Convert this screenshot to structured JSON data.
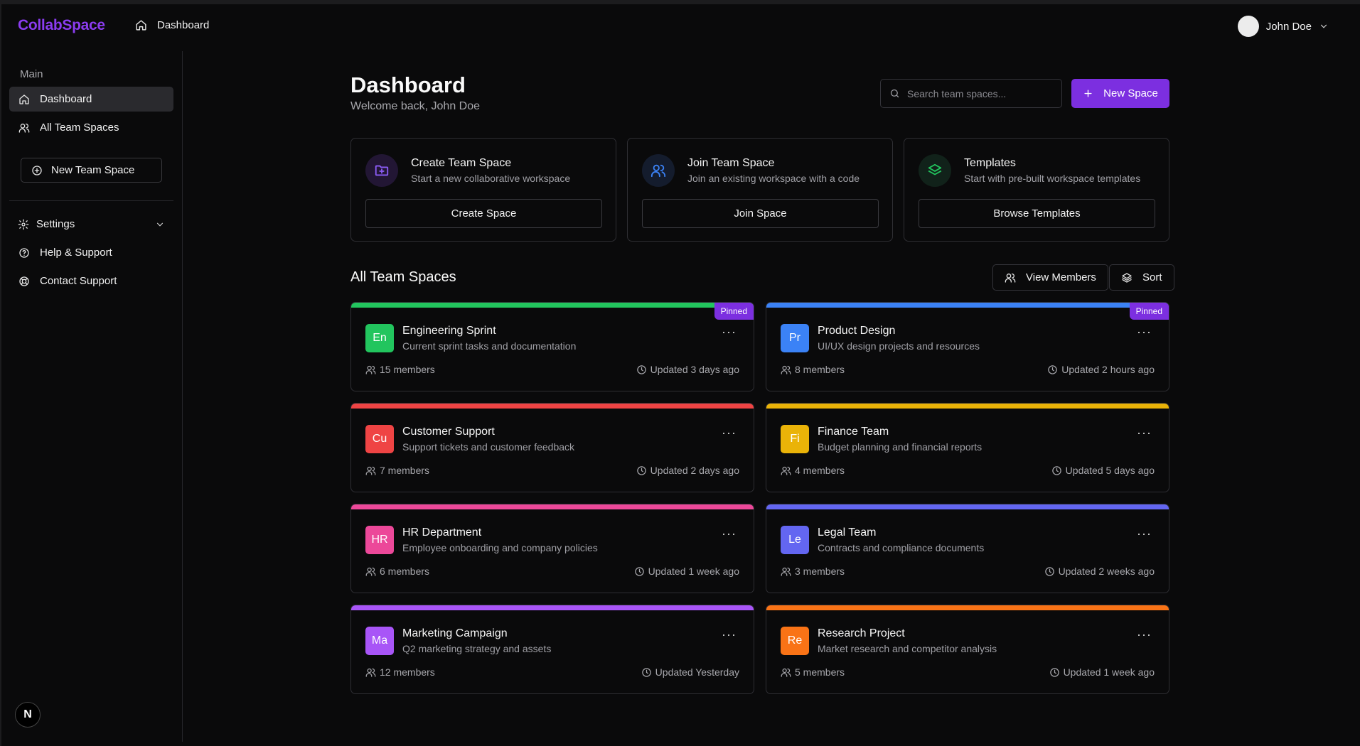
{
  "app": {
    "brand": "CollabSpace"
  },
  "header": {
    "breadcrumb": "Dashboard",
    "user_name": "John Doe"
  },
  "sidebar": {
    "section_heading": "Main",
    "items": [
      {
        "label": "Dashboard",
        "icon": "home-icon",
        "active": true
      },
      {
        "label": "All Team Spaces",
        "icon": "users-icon",
        "active": false
      }
    ],
    "new_team_space": "New Team Space",
    "settings": "Settings",
    "help": "Help & Support",
    "contact": "Contact Support",
    "footer_badge": "N"
  },
  "page": {
    "title": "Dashboard",
    "subtitle": "Welcome back, John Doe",
    "search_placeholder": "Search team spaces...",
    "new_space_button": "New Space"
  },
  "actions": [
    {
      "title": "Create Team Space",
      "desc": "Start a new collaborative workspace",
      "button": "Create Space",
      "icon": "folder-plus-icon",
      "color": "#8b5cf6"
    },
    {
      "title": "Join Team Space",
      "desc": "Join an existing workspace with a code",
      "button": "Join Space",
      "icon": "users-icon",
      "color": "#3b82f6"
    },
    {
      "title": "Templates",
      "desc": "Start with pre-built workspace templates",
      "button": "Browse Templates",
      "icon": "layers-icon",
      "color": "#22c55e"
    }
  ],
  "spaces_section": {
    "title": "All Team Spaces",
    "view_members": "View Members",
    "sort": "Sort"
  },
  "spaces": [
    {
      "initials": "En",
      "name": "Engineering Sprint",
      "desc": "Current sprint tasks and documentation",
      "members": "15 members",
      "updated": "Updated 3 days ago",
      "color": "#22c55e",
      "pinned": "Pinned"
    },
    {
      "initials": "Pr",
      "name": "Product Design",
      "desc": "UI/UX design projects and resources",
      "members": "8 members",
      "updated": "Updated 2 hours ago",
      "color": "#3b82f6",
      "pinned": "Pinned"
    },
    {
      "initials": "Cu",
      "name": "Customer Support",
      "desc": "Support tickets and customer feedback",
      "members": "7 members",
      "updated": "Updated 2 days ago",
      "color": "#ef4444",
      "pinned": ""
    },
    {
      "initials": "Fi",
      "name": "Finance Team",
      "desc": "Budget planning and financial reports",
      "members": "4 members",
      "updated": "Updated 5 days ago",
      "color": "#eab308",
      "pinned": ""
    },
    {
      "initials": "HR",
      "name": "HR Department",
      "desc": "Employee onboarding and company policies",
      "members": "6 members",
      "updated": "Updated 1 week ago",
      "color": "#ec4899",
      "pinned": ""
    },
    {
      "initials": "Le",
      "name": "Legal Team",
      "desc": "Contracts and compliance documents",
      "members": "3 members",
      "updated": "Updated 2 weeks ago",
      "color": "#6366f1",
      "pinned": ""
    },
    {
      "initials": "Ma",
      "name": "Marketing Campaign",
      "desc": "Q2 marketing strategy and assets",
      "members": "12 members",
      "updated": "Updated Yesterday",
      "color": "#a855f7",
      "pinned": ""
    },
    {
      "initials": "Re",
      "name": "Research Project",
      "desc": "Market research and competitor analysis",
      "members": "5 members",
      "updated": "Updated 1 week ago",
      "color": "#f97316",
      "pinned": ""
    }
  ]
}
